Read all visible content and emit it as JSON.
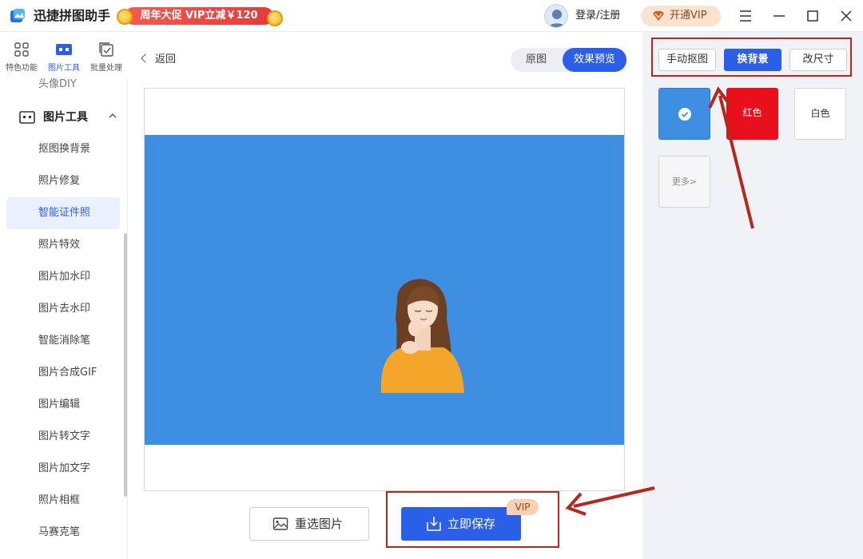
{
  "app": {
    "name": "迅捷拼图助手",
    "promo": "周年大促 VIP立减￥120",
    "login": "登录/注册",
    "vip_button": "开通VIP"
  },
  "sidebar": {
    "quick_tabs": [
      {
        "label": "特色功能",
        "icon": "grid-icon"
      },
      {
        "label": "图片工具",
        "icon": "toolbox-icon"
      },
      {
        "label": "批量处理",
        "icon": "batch-icon"
      }
    ],
    "partial_item": "头像DIY",
    "group": "图片工具",
    "items": [
      "抠图换背景",
      "照片修复",
      "智能证件照",
      "照片特效",
      "图片加水印",
      "图片去水印",
      "智能消除笔",
      "图片合成GIF",
      "图片编辑",
      "图片转文字",
      "图片加文字",
      "照片相框",
      "马赛克笔"
    ],
    "active_item": "智能证件照"
  },
  "main": {
    "back": "返回",
    "segments": [
      "原图",
      "效果预览"
    ],
    "active_segment": "效果预览",
    "preview_background": "#3e8fe1",
    "reselect_label": "重选图片",
    "save_label": "立即保存",
    "vip_tag": "VIP"
  },
  "panel": {
    "tabs": [
      "手动抠图",
      "换背景",
      "改尺寸"
    ],
    "active_tab": "换背景",
    "swatches": [
      {
        "label": "",
        "color": "#3e8fe1",
        "selected": true
      },
      {
        "label": "红色",
        "color": "#e8101c",
        "selected": false
      },
      {
        "label": "白色",
        "color": "#ffffff",
        "selected": false
      }
    ],
    "more": "更多>"
  },
  "colors": {
    "accent": "#2b5fe8",
    "annotation": "#b8271d"
  }
}
